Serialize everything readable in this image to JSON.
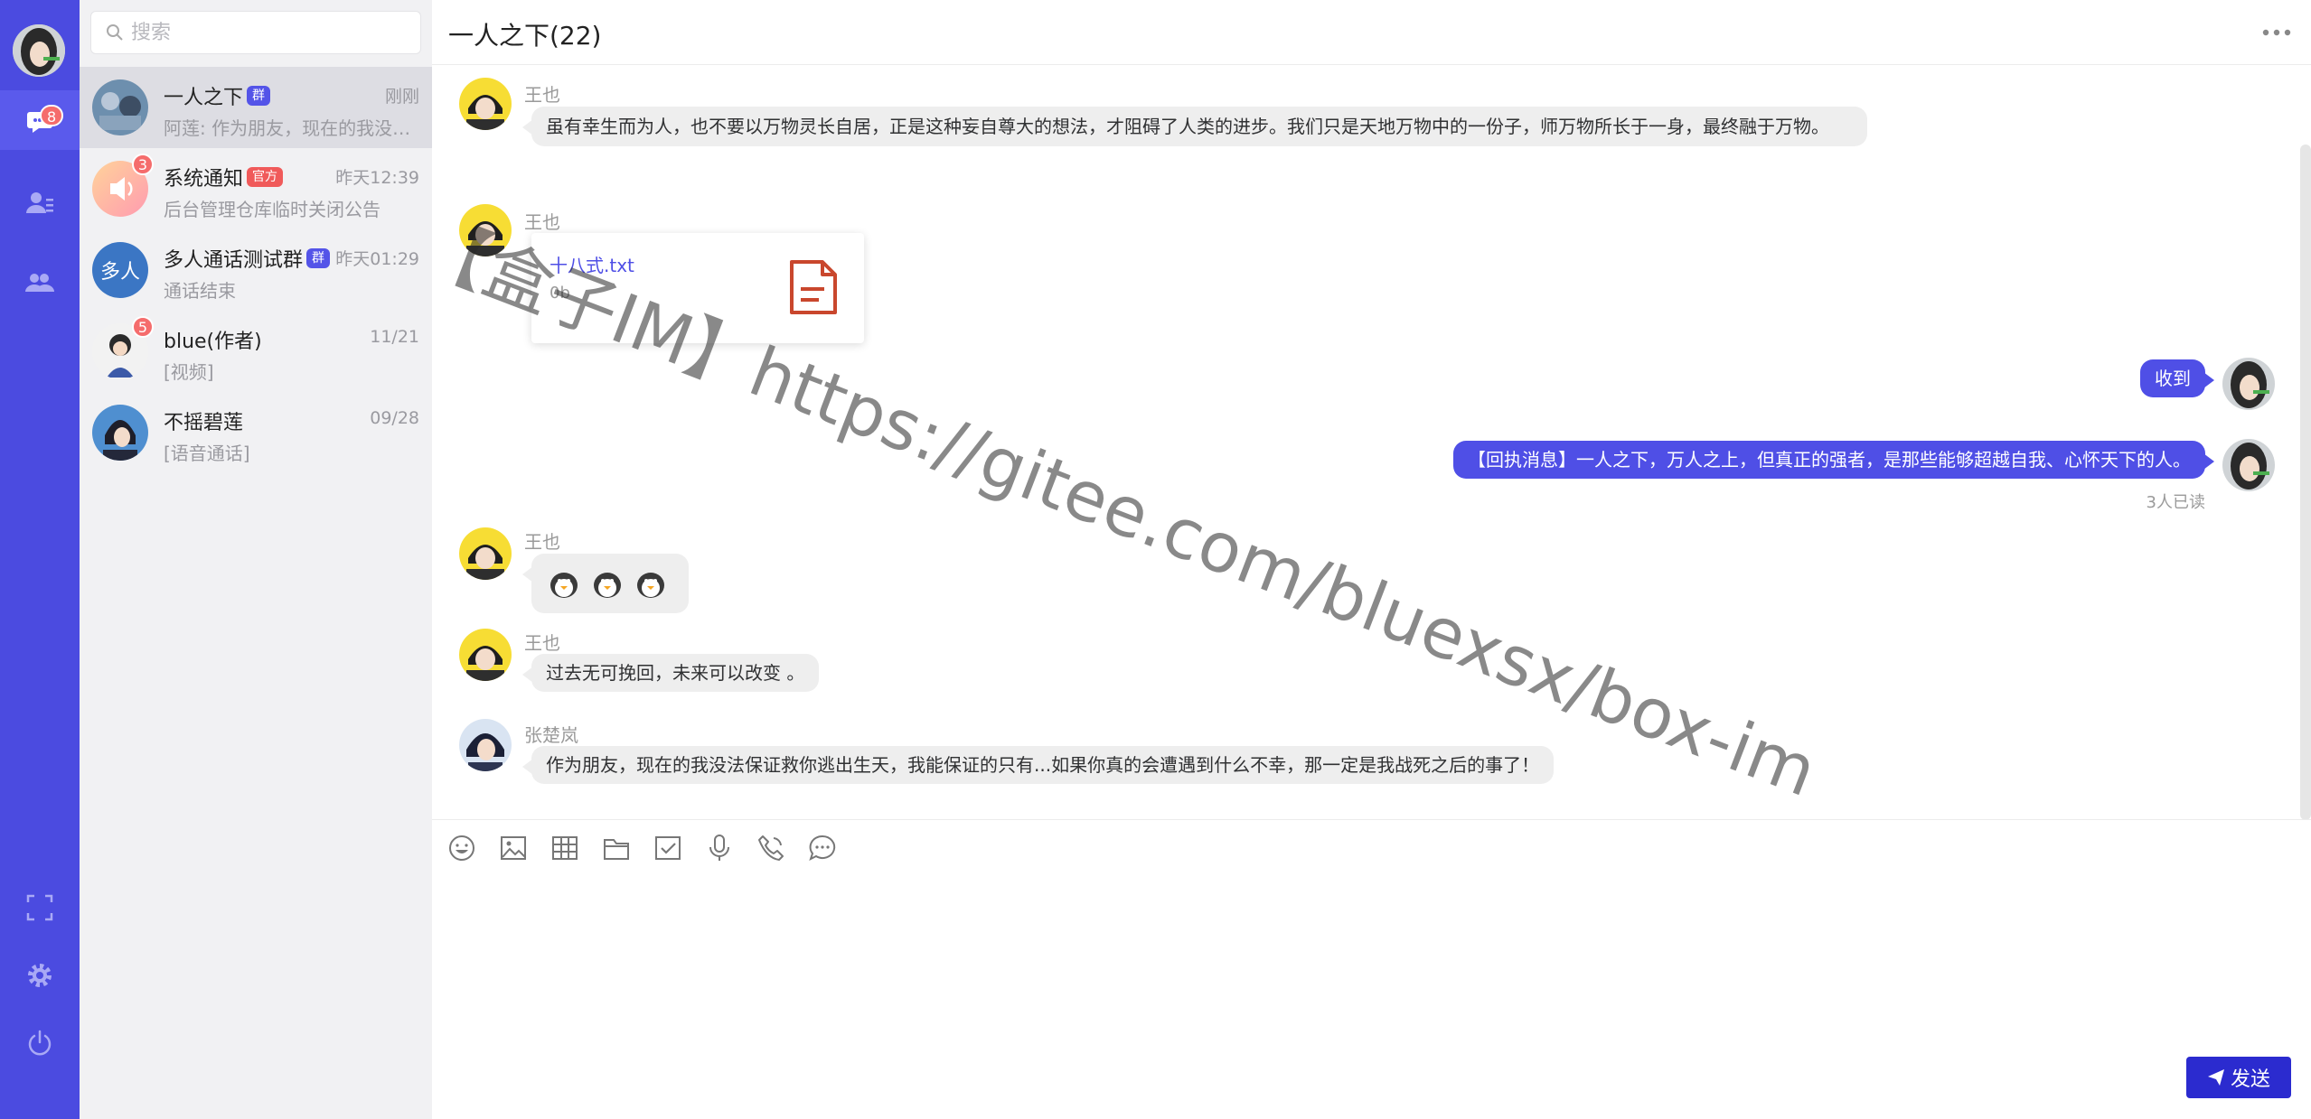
{
  "nav": {
    "unread_badge": "8",
    "icons": [
      "chat-icon",
      "contacts-icon",
      "groups-icon",
      "fullscreen-icon",
      "gear-icon",
      "power-icon"
    ]
  },
  "search": {
    "placeholder": "搜索"
  },
  "conversations": [
    {
      "name": "一人之下",
      "tag": "群",
      "time": "刚刚",
      "preview": "阿莲: 作为朋友，现在的我没法...",
      "badge": ""
    },
    {
      "name": "系统通知",
      "tag": "官方",
      "time": "昨天12:39",
      "preview": "后台管理仓库临时关闭公告",
      "badge": "3"
    },
    {
      "name": "多人通话测试群",
      "tag": "群",
      "time": "昨天01:29",
      "preview": "通话结束",
      "badge": "",
      "avatar_text": "多人"
    },
    {
      "name": "blue(作者)",
      "tag": "",
      "time": "11/21",
      "preview": "[视频]",
      "badge": "5"
    },
    {
      "name": "不摇碧莲",
      "tag": "",
      "time": "09/28",
      "preview": "[语音通话]",
      "badge": ""
    }
  ],
  "chat": {
    "title": "一人之下(22)",
    "messages": [
      {
        "sender": "王也",
        "text": "虽有幸生而为人，也不要以万物灵长自居，正是这种妄自尊大的想法，才阻碍了人类的进步。我们只是天地万物中的一份子，师万物所长于一身，最终融于万物。"
      },
      {
        "sender": "王也",
        "file_name": "十八式.txt",
        "file_size": "0b"
      },
      {
        "text": "收到"
      },
      {
        "text": "【回执消息】一人之下，万人之上，但真正的强者，是那些能够超越自我、心怀天下的人。",
        "read_status": "3人已读"
      },
      {
        "sender": "王也",
        "emoji_count": "3"
      },
      {
        "sender": "王也",
        "text": "过去无可挽回，未来可以改变 。"
      },
      {
        "sender": "张楚岚",
        "text": "作为朋友，现在的我没法保证救你逃出生天，我能保证的只有...如果你真的会遭遇到什么不幸，那一定是我战死之后的事了！"
      }
    ]
  },
  "toolbar": {
    "icons": [
      "emoji-icon",
      "image-icon",
      "table-icon",
      "folder-icon",
      "checkbox-icon",
      "microphone-icon",
      "phone-icon",
      "chat-bubble-icon"
    ]
  },
  "send": {
    "label": "发送"
  },
  "watermark": "【盒子IM】https://gitee.com/bluexsx/box-im",
  "colors": {
    "nav_bg": "#4b4be0",
    "accent": "#4f4fe6",
    "badge": "#f56c6c",
    "send_bg": "#2b2bcf"
  }
}
